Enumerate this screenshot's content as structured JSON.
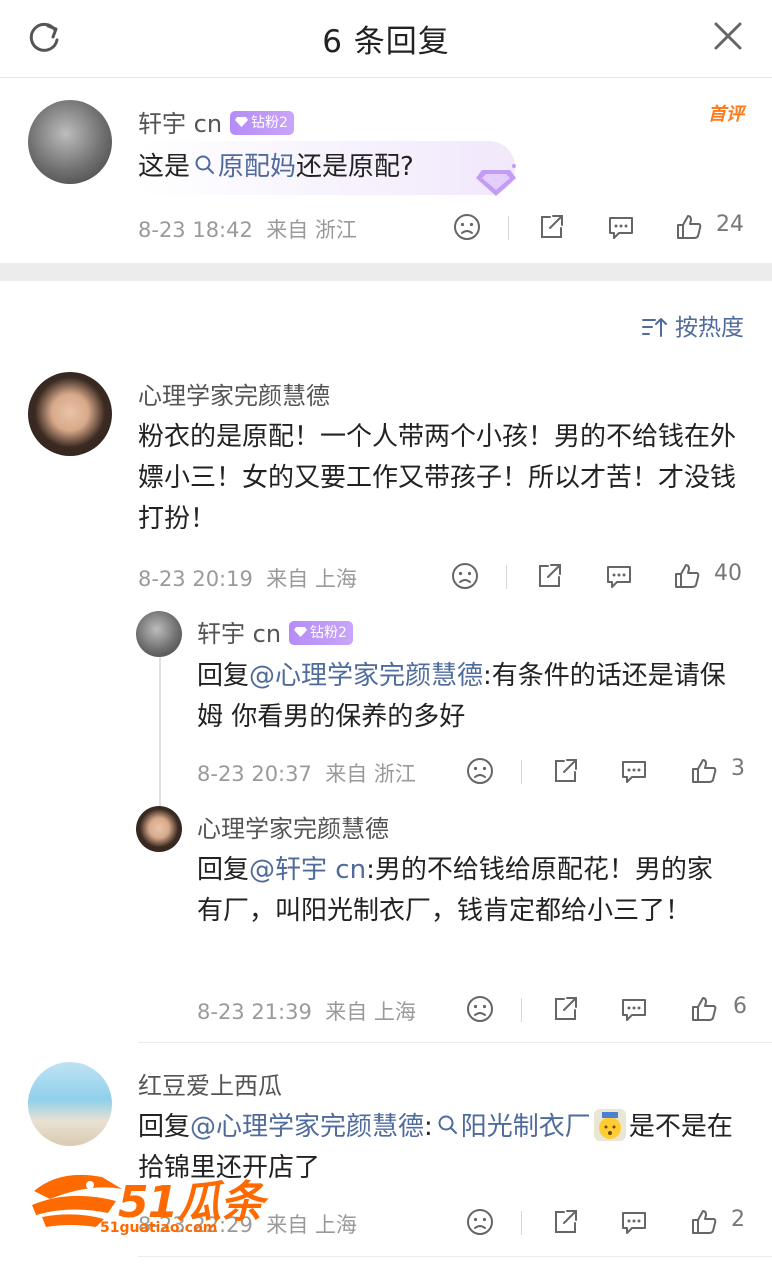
{
  "header": {
    "title": "6 条回复",
    "refresh_icon": "refresh-icon",
    "close_icon": "close-icon"
  },
  "root": {
    "user": "轩宇 cn",
    "badge": "钻粉2",
    "first_tag": "首评",
    "text_before": "这是",
    "topic": "原配妈",
    "text_after": "还是原配?",
    "time": "8-23 18:42",
    "from": "来自 浙江",
    "likes": "24"
  },
  "sort": {
    "label": "按热度"
  },
  "comments": [
    {
      "user": "心理学家完颜慧德",
      "text": "粉衣的是原配！一个人带两个小孩！男的不给钱在外嫖小三！女的又要工作又带孩子！所以才苦！才没钱打扮！",
      "time": "8-23 20:19",
      "from": "来自 上海",
      "likes": "40"
    }
  ],
  "replies": [
    {
      "user": "轩宇 cn",
      "badge": "钻粉2",
      "prefix": "回复",
      "mention": "@心理学家完颜慧德",
      "text": ":有条件的话还是请保姆 你看男的保养的多好",
      "time": "8-23 20:37",
      "from": "来自 浙江",
      "likes": "3"
    },
    {
      "user": "心理学家完颜慧德",
      "prefix": "回复",
      "mention": "@轩宇 cn",
      "text": ":男的不给钱给原配花！男的家有厂，叫阳光制衣厂，钱肯定都给小三了！",
      "time": "8-23 21:39",
      "from": "来自 上海",
      "likes": "6"
    }
  ],
  "comment2": {
    "user": "红豆爱上西瓜",
    "prefix": "回复",
    "mention": "@心理学家完颜慧德",
    "colon": ":",
    "topic": "阳光制衣厂",
    "text_after": "是不是在拾锦里还开店了",
    "time": "8-23 22:29",
    "from": "来自 上海",
    "likes": "2"
  },
  "watermark": {
    "logo_text": "51瓜条",
    "url": "51guatiao.com"
  },
  "colors": {
    "link": "#4f6b9c",
    "badge": "#b58cf7",
    "watermark": "#ff6a00",
    "first": "#ff7a1a"
  }
}
